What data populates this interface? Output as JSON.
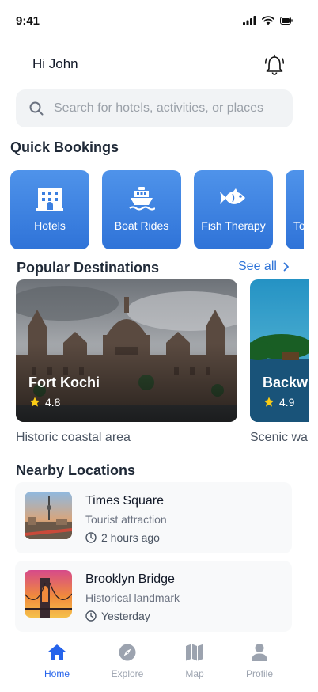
{
  "status_bar": {
    "time": "9:41"
  },
  "header": {
    "greeting": "Hi John"
  },
  "search": {
    "placeholder": "Search for hotels, activities, or places"
  },
  "quick_bookings": {
    "title": "Quick Bookings",
    "items": [
      {
        "label": "Hotels",
        "icon": "building-icon"
      },
      {
        "label": "Boat Rides",
        "icon": "boat-icon"
      },
      {
        "label": "Fish Therapy",
        "icon": "fish-icon"
      },
      {
        "label": "To",
        "icon": "tour-icon"
      }
    ]
  },
  "popular": {
    "title": "Popular Destinations",
    "see_all": "See all",
    "items": [
      {
        "name": "Fort Kochi",
        "rating": "4.8",
        "description": "Historic coastal area"
      },
      {
        "name": "Backw",
        "rating": "4.9",
        "description": "Scenic wa"
      }
    ]
  },
  "nearby": {
    "title": "Nearby Locations",
    "items": [
      {
        "name": "Times Square",
        "category": "Tourist attraction",
        "time": "2 hours ago"
      },
      {
        "name": "Brooklyn Bridge",
        "category": "Historical landmark",
        "time": "Yesterday"
      }
    ]
  },
  "tabbar": {
    "items": [
      {
        "label": "Home",
        "icon": "home-icon",
        "active": true
      },
      {
        "label": "Explore",
        "icon": "compass-icon",
        "active": false
      },
      {
        "label": "Map",
        "icon": "map-icon",
        "active": false
      },
      {
        "label": "Profile",
        "icon": "user-icon",
        "active": false
      }
    ]
  },
  "colors": {
    "accent": "#2563eb",
    "tile": "#3b82e6",
    "star": "#facc15"
  }
}
